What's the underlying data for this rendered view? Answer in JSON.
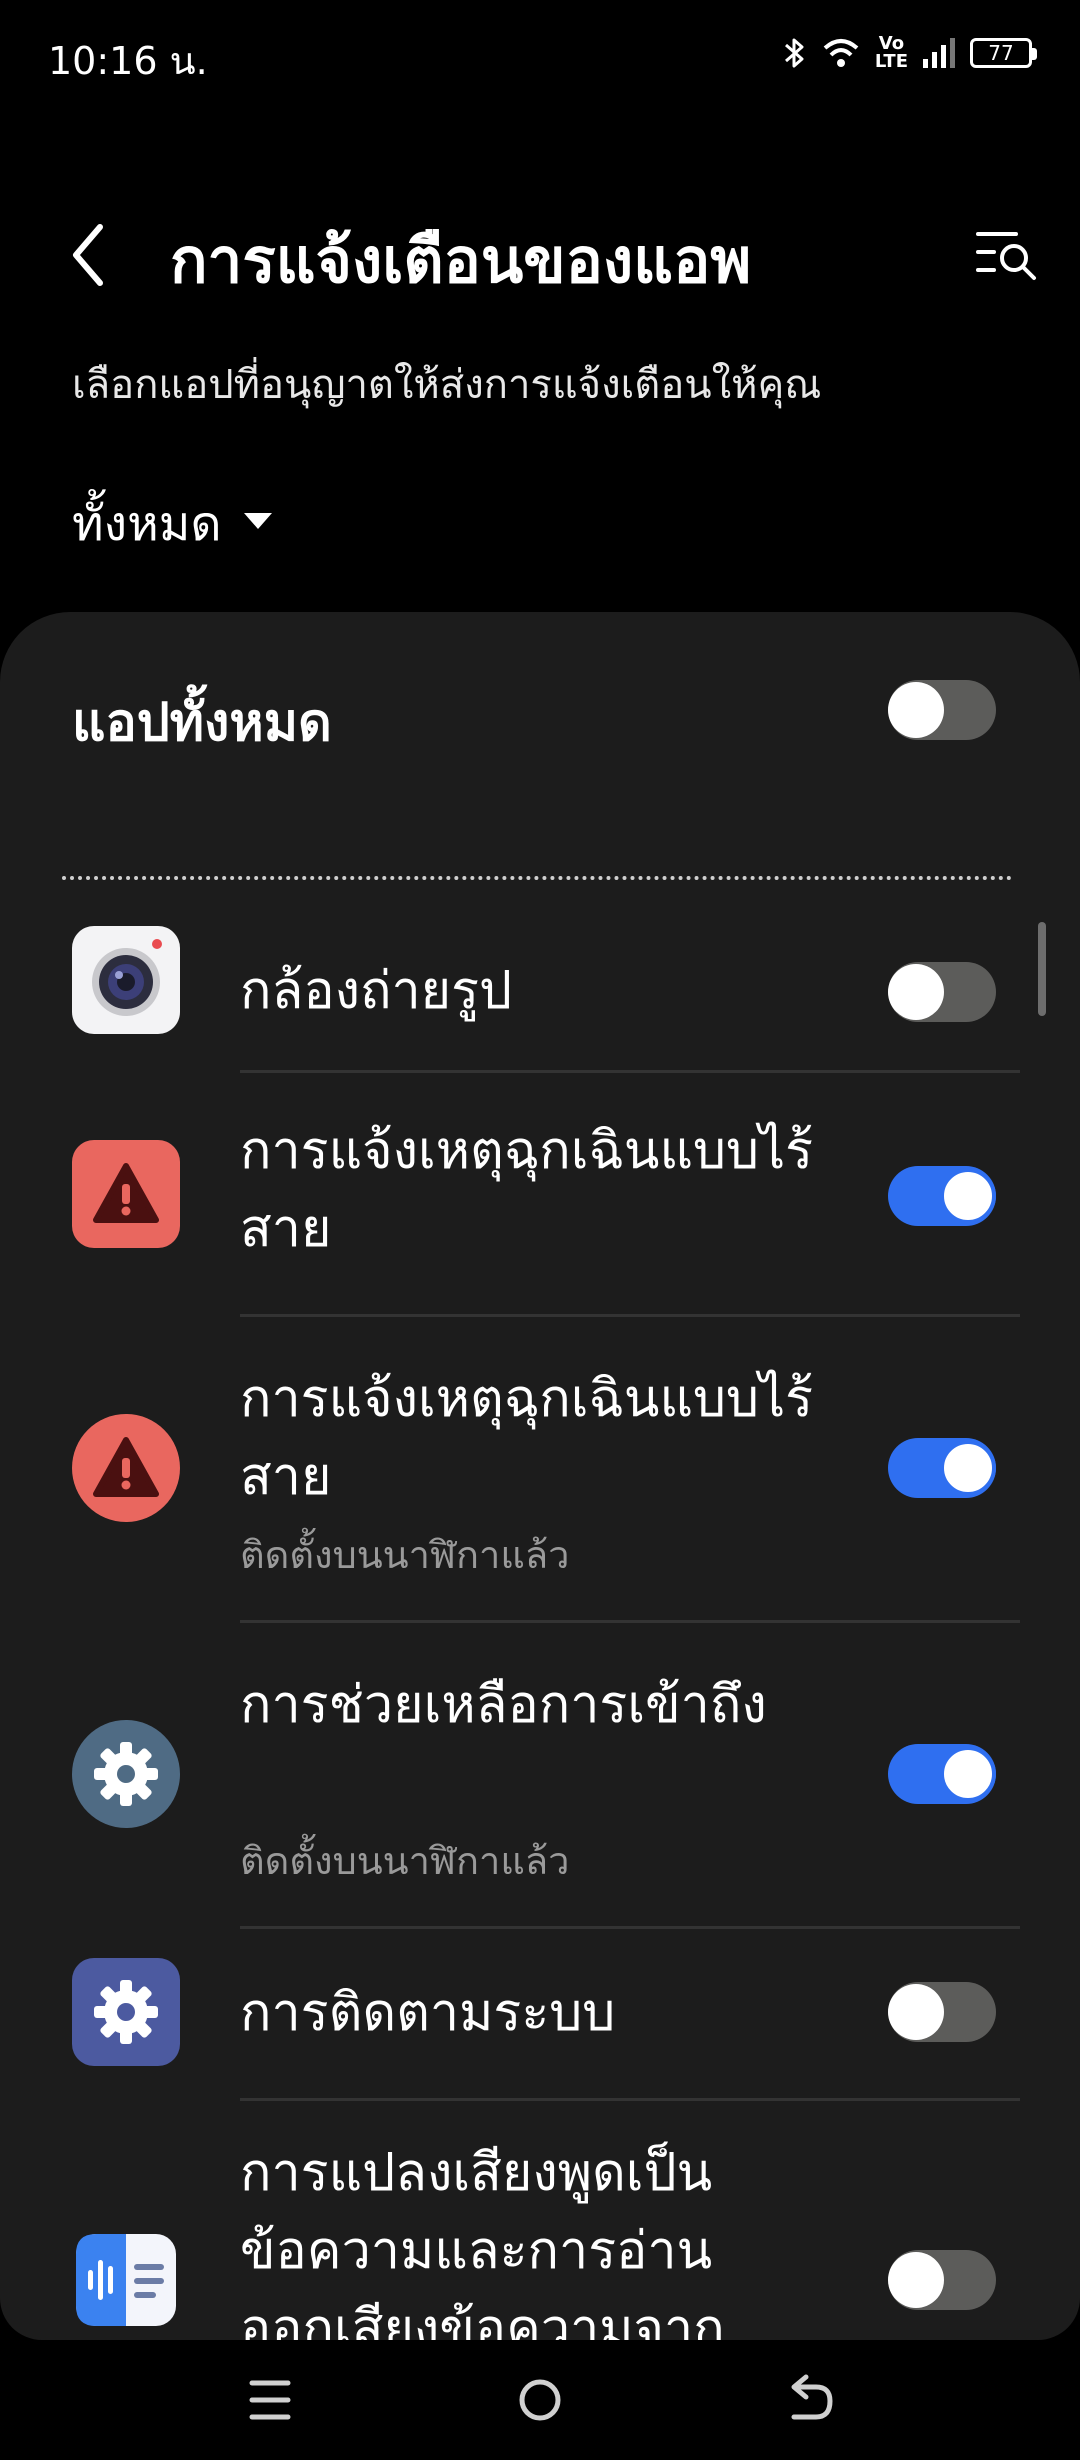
{
  "status_bar": {
    "time": "10:16 น.",
    "volte_top": "Vo",
    "volte_bottom": "LTE",
    "battery": "77",
    "icons": [
      "bluetooth-icon",
      "wifi-icon",
      "volte-icon",
      "signal-icon",
      "battery-icon"
    ]
  },
  "header": {
    "title": "การแจ้งเตือนของแอพ",
    "subtitle": "เลือกแอปที่อนุญาตให้ส่งการแจ้งเตือนให้คุณ",
    "filter_label": "ทั้งหมด",
    "back_icon": "back-arrow-icon",
    "menu_icon": "filter-search-icon"
  },
  "all_apps": {
    "label": "แอปทั้งหมด",
    "enabled": false
  },
  "apps": [
    {
      "name": "กล้องถ่ายรูป",
      "subtitle": "",
      "enabled": false,
      "icon": "camera-icon"
    },
    {
      "name": "การแจ้งเหตุฉุกเฉินแบบไร้สาย",
      "subtitle": "",
      "enabled": true,
      "icon": "emergency-alert-icon",
      "icon_color": "#e9675f"
    },
    {
      "name": "การแจ้งเหตุฉุกเฉินแบบไร้สาย",
      "subtitle": "ติดตั้งบนนาฬิกาแล้ว",
      "enabled": true,
      "icon": "emergency-alert-icon",
      "icon_color": "#e9675f"
    },
    {
      "name": "การช่วยเหลือการเข้าถึง",
      "subtitle": "ติดตั้งบนนาฬิกาแล้ว",
      "enabled": true,
      "icon": "gear-icon",
      "icon_color": "#4f6b84"
    },
    {
      "name": "การติดตามระบบ",
      "subtitle": "",
      "enabled": false,
      "icon": "gear-icon",
      "icon_color": "#4c5aa0"
    },
    {
      "name": "การแปลงเสียงพูดเป็นข้อความและการอ่านออกเสียงข้อความจาก",
      "subtitle": "",
      "enabled": false,
      "icon": "speech-to-text-icon"
    }
  ],
  "colors": {
    "accent": "#2f6ff0",
    "card_background": "#1c1c1c",
    "switch_off": "#5c5c5a"
  },
  "nav_bar": {
    "icons": [
      "recents-icon",
      "home-icon",
      "back-icon"
    ]
  }
}
